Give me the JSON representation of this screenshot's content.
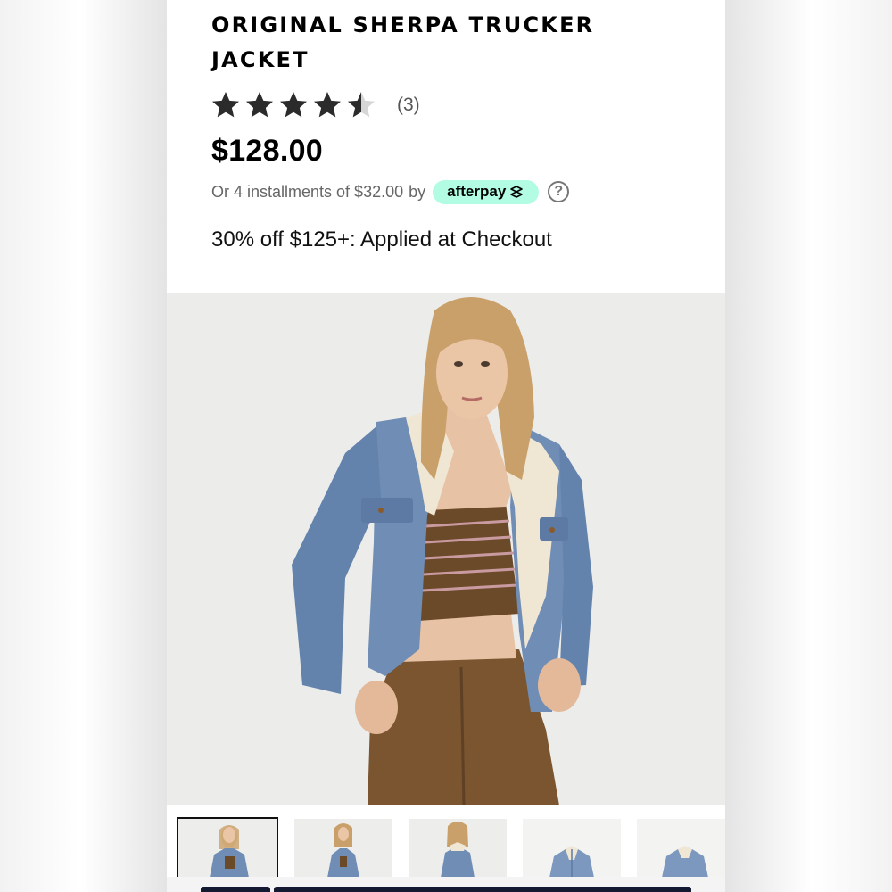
{
  "product": {
    "title": "ORIGINAL SHERPA TRUCKER JACKET",
    "rating": 4.5,
    "rating_max": 5,
    "review_count": "(3)",
    "price": "$128.00"
  },
  "afterpay": {
    "text_prefix": "Or 4 installments of $32.00",
    "text_by": "by",
    "badge_label": "afterpay",
    "help_label": "?",
    "badge_color": "#b2fce4"
  },
  "promo": {
    "text": "30% off $125+: Applied at Checkout"
  },
  "gallery": {
    "selected_index": 0,
    "thumbnail_count": 5
  },
  "colors": {
    "denim": "#6f8db5",
    "sherpa": "#efe6d4",
    "pants": "#7a5530",
    "top": "#6b4a2a"
  }
}
